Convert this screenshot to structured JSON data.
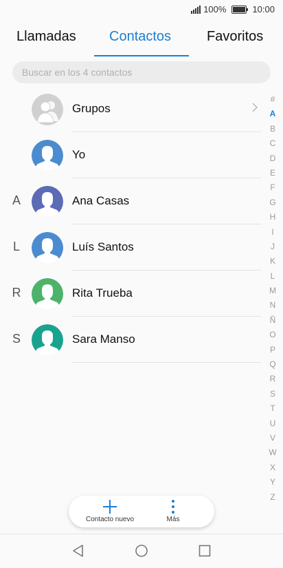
{
  "status": {
    "battery": "100%",
    "time": "10:00",
    "battery_level": 1.0
  },
  "tabs": [
    {
      "label": "Llamadas",
      "active": false
    },
    {
      "label": "Contactos",
      "active": true
    },
    {
      "label": "Favoritos",
      "active": false
    }
  ],
  "search": {
    "placeholder": "Buscar en los 4 contactos"
  },
  "groups_row": {
    "label": "Grupos",
    "icon": "chevron-right-icon"
  },
  "me_row": {
    "label": "Yo"
  },
  "contacts": [
    {
      "letter": "A",
      "name": "Ana Casas",
      "color": "#5b6bb5"
    },
    {
      "letter": "L",
      "name": "Luís Santos",
      "color": "#4a8ccf"
    },
    {
      "letter": "R",
      "name": "Rita Trueba",
      "color": "#4cb36b"
    },
    {
      "letter": "S",
      "name": "Sara Manso",
      "color": "#19a38f"
    }
  ],
  "alphabet": [
    "#",
    "A",
    "B",
    "C",
    "D",
    "E",
    "F",
    "G",
    "H",
    "I",
    "J",
    "K",
    "L",
    "M",
    "N",
    "Ñ",
    "O",
    "P",
    "Q",
    "R",
    "S",
    "T",
    "U",
    "V",
    "W",
    "X",
    "Y",
    "Z"
  ],
  "alphabet_active": "A",
  "actions": {
    "new_contact": "Contacto nuevo",
    "more": "Más"
  },
  "colors": {
    "accent": "#1a7fd4",
    "me_avatar": "#4a8ccf",
    "group_avatar": "#d0d0d0"
  }
}
